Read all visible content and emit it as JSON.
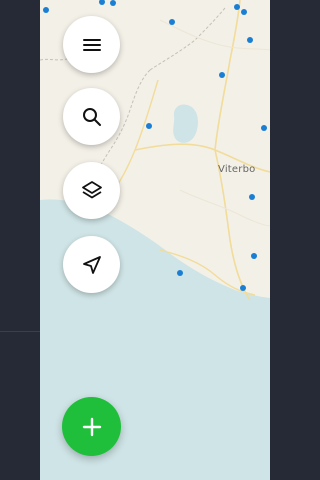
{
  "map": {
    "place_labels": [
      {
        "text": "Viterbo"
      }
    ],
    "colors": {
      "land": "#f3f0e7",
      "water": "#cfe4e6",
      "lake": "#cfe4e6",
      "road": "#f2d88a",
      "border": "#bdbdbd",
      "pin": "#1a7fd4"
    }
  },
  "controls": [
    {
      "name": "menu-button",
      "icon": "menu-icon"
    },
    {
      "name": "search-button",
      "icon": "search-icon"
    },
    {
      "name": "layers-button",
      "icon": "layers-icon"
    },
    {
      "name": "locate-button",
      "icon": "navigation-arrow-icon"
    }
  ],
  "add_button": {
    "icon": "plus-icon",
    "color": "#1fbf3c"
  }
}
